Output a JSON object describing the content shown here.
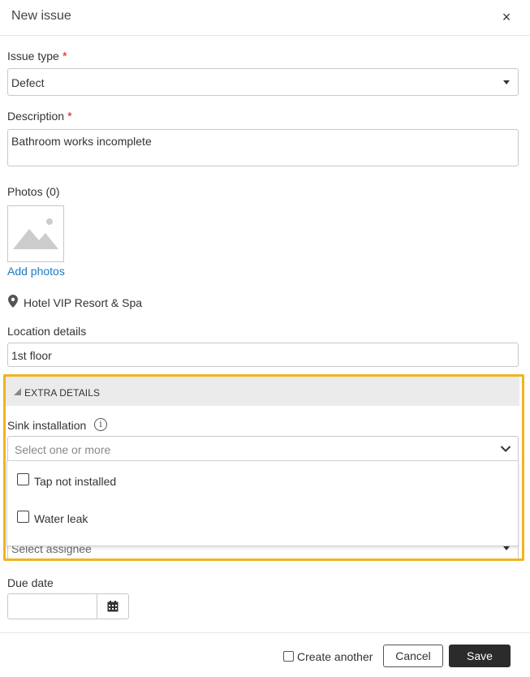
{
  "dialog": {
    "title": "New issue",
    "close_glyph": "×"
  },
  "issue_type": {
    "label": "Issue type",
    "required_mark": "*",
    "value": "Defect"
  },
  "description": {
    "label": "Description",
    "required_mark": "*",
    "value": "Bathroom works incomplete"
  },
  "photos": {
    "label": "Photos (0)",
    "add_link": "Add photos"
  },
  "location": {
    "name": "Hotel VIP Resort & Spa",
    "details_label": "Location details",
    "details_value": "1st floor"
  },
  "extra_details": {
    "header": "EXTRA DETAILS",
    "sink_label": "Sink installation",
    "info_glyph": "i",
    "select_placeholder": "Select one or more",
    "options": [
      {
        "label": "Tap not installed",
        "checked": false
      },
      {
        "label": "Water leak",
        "checked": false
      }
    ],
    "assignee_placeholder": "Select assignee"
  },
  "due_date": {
    "label": "Due date",
    "value": ""
  },
  "footer": {
    "create_another": "Create another",
    "cancel": "Cancel",
    "save": "Save"
  },
  "colors": {
    "accent_outline": "#f0b420",
    "link": "#1a7bbf",
    "required": "#e02020",
    "save_bg": "#2b2b2b"
  }
}
